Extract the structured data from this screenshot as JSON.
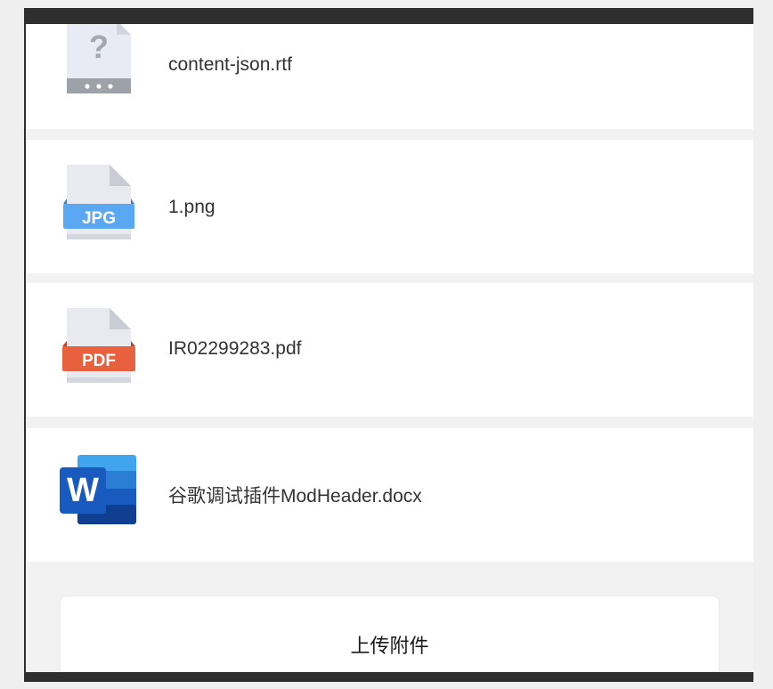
{
  "files": [
    {
      "name": "content-json.rtf",
      "icon": "unknown-file-icon"
    },
    {
      "name": "1.png",
      "icon": "jpg-file-icon",
      "badge": "JPG",
      "badge_color": "#5aa7f3"
    },
    {
      "name": "IR02299283.pdf",
      "icon": "pdf-file-icon",
      "badge": "PDF",
      "badge_color": "#e8613f"
    },
    {
      "name": "谷歌调试插件ModHeader.docx",
      "icon": "word-file-icon",
      "badge": "W",
      "badge_color": "#2b579a"
    }
  ],
  "upload": {
    "label": "上传附件"
  }
}
